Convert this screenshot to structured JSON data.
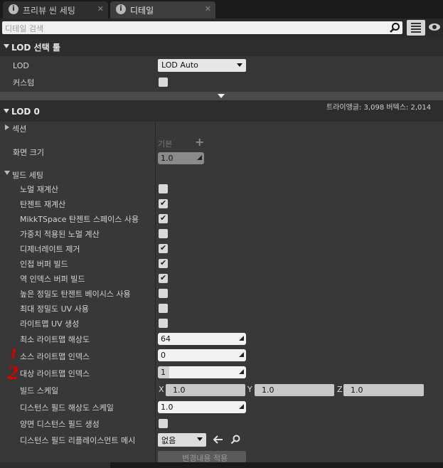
{
  "tabs": [
    {
      "label": "프리뷰 씬 세팅",
      "icon": "info-icon",
      "active": false
    },
    {
      "label": "디테일",
      "icon": "info-icon",
      "active": true
    }
  ],
  "search": {
    "placeholder": "디테일 검색"
  },
  "lod_picker": {
    "title": "LOD 선택 툴",
    "lod_label": "LOD",
    "lod_value": "LOD Auto",
    "custom_label": "커스텀"
  },
  "lod0": {
    "title": "LOD 0",
    "stats": "트라이앵글: 3,098   버텍스: 2,014",
    "sections_label": "섹션",
    "screen_size_label": "화면 크기",
    "screen_size_default_label": "기본",
    "screen_size_value": "1.0"
  },
  "build_settings": {
    "title": "빌드 세팅",
    "checkboxes": [
      {
        "label": "노멀 재계산",
        "checked": false
      },
      {
        "label": "탄젠트 재계산",
        "checked": true
      },
      {
        "label": "MikkTSpace 탄젠트 스페이스 사용",
        "checked": true
      },
      {
        "label": "가중치 적용된 노멀 계산",
        "checked": false
      },
      {
        "label": "디제너레이트 제거",
        "checked": true
      },
      {
        "label": "인접 버퍼 빌드",
        "checked": true
      },
      {
        "label": "역 인덱스 버퍼 빌드",
        "checked": true
      },
      {
        "label": "높은 정밀도 탄젠트 베이시스 사용",
        "checked": false
      },
      {
        "label": "최대 정밀도 UV 사용",
        "checked": false
      },
      {
        "label": "라이트맵 UV 생성",
        "checked": false
      }
    ],
    "min_lightmap_res_label": "최소 라이트맵 해상도",
    "min_lightmap_res_value": "64",
    "src_lightmap_index_label": "소스 라이트맵 인덱스",
    "src_lightmap_index_value": "0",
    "dst_lightmap_index_label": "대상 라이트맵 인덱스",
    "dst_lightmap_index_value": "1",
    "build_scale_label": "빌드 스케일",
    "build_scale": {
      "x_label": "X",
      "x": "1.0",
      "y_label": "Y",
      "y": "1.0",
      "z_label": "Z",
      "z": "1.0"
    },
    "df_res_scale_label": "디스턴스 필드 해상도 스케일",
    "df_res_scale_value": "1.0",
    "two_sided_df_label": "양면 디스턴스 필드 생성",
    "two_sided_df_checked": false,
    "df_replacement_label": "디스턴스 필드 리플레이스먼트 메시",
    "df_replacement_value": "없음",
    "apply_button_label": "변경내용 적용"
  },
  "annotations": {
    "mark1": "1",
    "mark2": "2"
  },
  "colors": {
    "panel_bg": "#383838",
    "header_bg": "#2d2d2d",
    "tab_bar": "#1a1a1a",
    "annotation_red": "#d40000"
  }
}
